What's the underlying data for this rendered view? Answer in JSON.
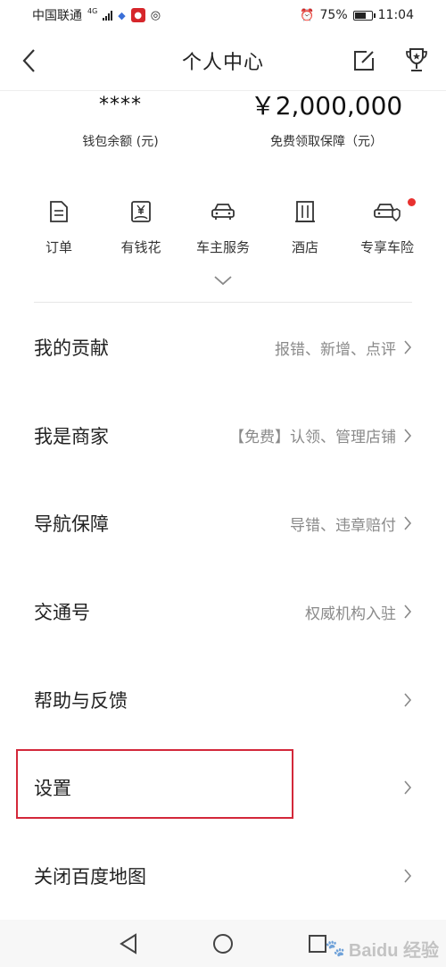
{
  "status_bar": {
    "carrier": "中国联通",
    "network": "4G",
    "battery": "75%",
    "time": "11:04",
    "battery_level": 0.75
  },
  "header": {
    "title": "个人中心"
  },
  "stats": {
    "wallet_value": "****",
    "wallet_label": "钱包余额 (元)",
    "insurance_value": "￥2,000,000",
    "insurance_label": "免费领取保障（元）"
  },
  "quick_actions": [
    {
      "label": "订单",
      "icon": "document-icon"
    },
    {
      "label": "有钱花",
      "icon": "yen-card-icon"
    },
    {
      "label": "车主服务",
      "icon": "car-icon"
    },
    {
      "label": "酒店",
      "icon": "building-icon"
    },
    {
      "label": "专享车险",
      "icon": "car-shield-icon",
      "badge": true
    }
  ],
  "menu": [
    {
      "title": "我的贡献",
      "hint": "报错、新增、点评"
    },
    {
      "title": "我是商家",
      "hint": "【免费】认领、管理店铺"
    },
    {
      "title": "导航保障",
      "hint": "导错、违章赔付"
    },
    {
      "title": "交通号",
      "hint": "权威机构入驻"
    },
    {
      "title": "帮助与反馈",
      "hint": ""
    },
    {
      "title": "设置",
      "hint": ""
    },
    {
      "title": "关闭百度地图",
      "hint": ""
    }
  ],
  "watermark": "Baidu 经验",
  "colors": {
    "highlight": "#d3283a",
    "badge": "#e8312f",
    "hint": "#8a8a8a"
  }
}
